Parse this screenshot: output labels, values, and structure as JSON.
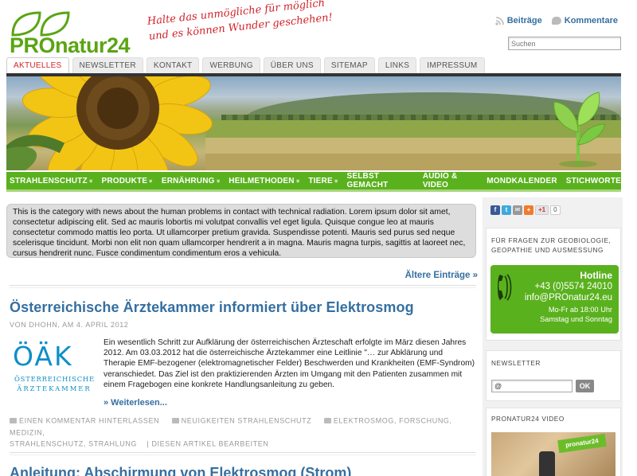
{
  "brand": {
    "logo_text": "PROnatur24",
    "slogan_line1": "Halte das unmögliche für möglich",
    "slogan_line2": "und es können Wunder geschehen!"
  },
  "header": {
    "feed_posts": "Beiträge",
    "feed_comments": "Kommentare",
    "search_placeholder": "Suchen"
  },
  "top_nav": [
    {
      "label": "AKTUELLES",
      "active": true
    },
    {
      "label": "NEWSLETTER"
    },
    {
      "label": "KONTAKT"
    },
    {
      "label": "WERBUNG"
    },
    {
      "label": "ÜBER UNS"
    },
    {
      "label": "SITEMAP"
    },
    {
      "label": "LINKS"
    },
    {
      "label": "IMPRESSUM"
    }
  ],
  "categories": [
    {
      "label": "STRAHLENSCHUTZ",
      "chevron": "»"
    },
    {
      "label": "PRODUKTE",
      "chevron": "»"
    },
    {
      "label": "ERNÄHRUNG",
      "chevron": "»"
    },
    {
      "label": "HEILMETHODEN",
      "chevron": "»"
    },
    {
      "label": "TIERE",
      "chevron": "»"
    },
    {
      "label": "SELBST GEMACHT"
    },
    {
      "label": "AUDIO & VIDEO"
    },
    {
      "label": "MONDKALENDER"
    },
    {
      "label": "STICHWORTE"
    }
  ],
  "intro_text": "This is the category with news about the human problems in contact with technical radiation.  Lorem ipsum dolor sit amet, consectetur adipiscing elit. Sed ac mauris lobortis mi volutpat convallis vel eget ligula. Quisque congue leo at mauris consectetur commodo mattis leo porta. Ut ullamcorper pretium gravida. Suspendisse potenti. Mauris sed purus sed neque scelerisque tincidunt. Morbi non elit non quam ullamcorper hendrerit a in magna. Mauris magna turpis, sagittis at laoreet nec, cursus hendrerit nunc. Fusce condimentum condimentum eros a vehicula.",
  "older_entries": "Ältere Einträge »",
  "post": {
    "title": "Österreichische Ärztekammer informiert über Elektrosmog",
    "meta": "VON DHOHN, AM 4. APRIL 2012",
    "logo_letters": "ÖÄK",
    "logo_sub_line1": "ÖSTERREICHISCHE",
    "logo_sub_line2": "ÄRZTEKAMMER",
    "body": "Ein wesentlich Schritt zur Aufklärung der österreichischen Ärzteschaft erfolgte im März diesen Jahres 2012. Am 03.03.2012 hat die österreichische Ärztekammer eine Leitlinie \"… zur Abklärung und Therapie EMF-bezogener (elektromagnetischer Felder) Beschwerden und Krankheiten (EMF-Syndrom) veranschiedet. Das Ziel ist den praktizierenden Ärzten im Umgang mit den Patienten zusammen mit einem Fragebogen eine konkrete Handlungsanleitung zu geben.",
    "read_more": "» Weiterlesen...",
    "comment_link": "EINEN KOMMENTAR HINTERLASSEN",
    "category": "NEUIGKEITEN STRAHLENSCHUTZ",
    "tags": "ELEKTROSMOG, FORSCHUNG, MEDIZIN,",
    "tags2": "STRAHLENSCHUTZ, STRAHLUNG",
    "edit": "| DIESEN ARTIKEL BEARBEITEN"
  },
  "post2": {
    "title": "Anleitung: Abschirmung von Elektrosmog (Strom)"
  },
  "sidebar": {
    "share_count": "0",
    "gplus_label": "+1",
    "geo_title": "FÜR FRAGEN ZUR GEOBIOLOGIE, GEOPATHIE UND AUSMESSUNG",
    "hotline_title": "Hotline",
    "hotline_phone": "+43 (0)5574 24010",
    "hotline_email": "info@PROnatur24.eu",
    "hotline_hours1": "Mo-Fr ab 18:00 Uhr",
    "hotline_hours2": "Samstag und Sonntag",
    "newsletter_title": "NEWSLETTER",
    "newsletter_value": "@",
    "newsletter_button": "OK",
    "video_title": "PRONATUR24 VIDEO",
    "video_sticker": "pronatur24"
  },
  "colors": {
    "brand_green": "#5ab11e",
    "link_blue": "#356fa0",
    "slogan_red": "#d2232a",
    "oeak_blue": "#0d8fc7"
  }
}
